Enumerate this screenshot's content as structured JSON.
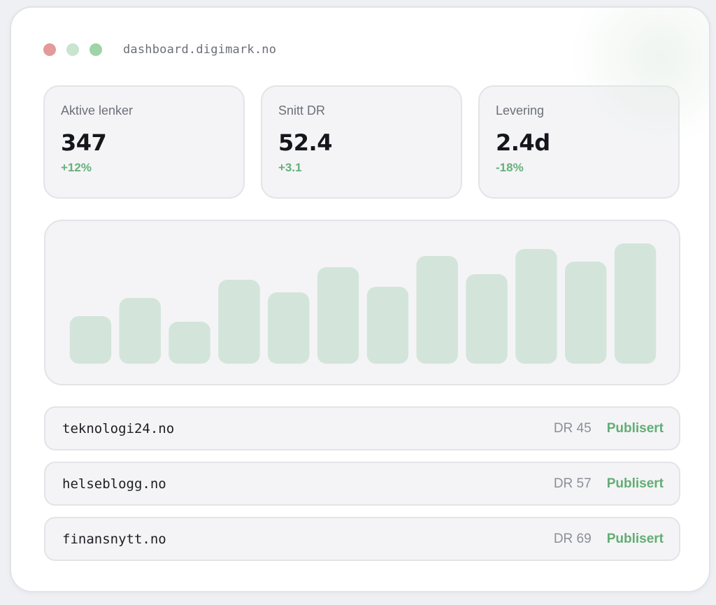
{
  "window": {
    "url": "dashboard.digimark.no",
    "dots": [
      {
        "name": "close",
        "color": "#e39a9a"
      },
      {
        "name": "minimize",
        "color": "#c9e4cf"
      },
      {
        "name": "maximize",
        "color": "#9fd3a8"
      }
    ]
  },
  "stats": [
    {
      "label": "Aktive lenker",
      "value": "347",
      "delta": "+12%"
    },
    {
      "label": "Snitt DR",
      "value": "52.4",
      "delta": "+3.1"
    },
    {
      "label": "Levering",
      "value": "2.4d",
      "delta": "-18%"
    }
  ],
  "colors": {
    "accent_green": "#62ad74",
    "bar_fill": "#d3e5da"
  },
  "chart_data": {
    "type": "bar",
    "categories": [],
    "values": [
      34,
      47,
      30,
      60,
      51,
      69,
      55,
      77,
      64,
      82,
      73,
      86
    ],
    "title": "",
    "xlabel": "",
    "ylabel": "",
    "ylim": [
      0,
      100
    ],
    "grid": false
  },
  "links": [
    {
      "domain": "teknologi24.no",
      "dr": "DR 45",
      "status": "Publisert"
    },
    {
      "domain": "helseblogg.no",
      "dr": "DR 57",
      "status": "Publisert"
    },
    {
      "domain": "finansnytt.no",
      "dr": "DR 69",
      "status": "Publisert"
    }
  ]
}
